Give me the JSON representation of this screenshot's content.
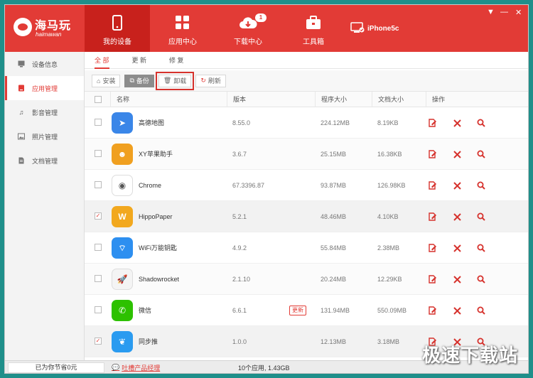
{
  "app": {
    "logo_cn": "海马玩",
    "logo_en": "haimawan"
  },
  "nav": [
    {
      "label": "我的设备",
      "icon": "phone-icon"
    },
    {
      "label": "应用中心",
      "icon": "grid-apps-icon"
    },
    {
      "label": "下载中心",
      "icon": "cloud-download-icon",
      "badge": "1"
    },
    {
      "label": "工具箱",
      "icon": "toolbox-icon"
    }
  ],
  "device": {
    "name": "iPhone5c",
    "icon": "device-connected-icon"
  },
  "window_controls": {
    "menu": "▼",
    "minimize": "—",
    "close": "✕"
  },
  "sidebar": {
    "items": [
      {
        "label": "设备信息",
        "icon": "monitor-icon"
      },
      {
        "label": "应用管理",
        "icon": "app-box-icon",
        "active": true
      },
      {
        "label": "影音管理",
        "icon": "music-note-icon"
      },
      {
        "label": "照片管理",
        "icon": "photo-icon"
      },
      {
        "label": "文档管理",
        "icon": "document-icon"
      }
    ]
  },
  "subtabs": [
    {
      "label": "全 部",
      "active": true
    },
    {
      "label": "更 新"
    },
    {
      "label": "修 复"
    }
  ],
  "toolbar": {
    "install": "安装",
    "backup": "备份",
    "uninstall": "卸载",
    "refresh": "刷新"
  },
  "table": {
    "headers": {
      "name": "名称",
      "version": "版本",
      "app_size": "程序大小",
      "doc_size": "文档大小",
      "actions": "操作"
    },
    "update_label": "更新",
    "rows": [
      {
        "name": "高德地图",
        "version": "8.55.0",
        "app_size": "224.12MB",
        "doc_size": "8.19KB",
        "checked": false,
        "icon": "amap-icon",
        "color": "#3a86e8"
      },
      {
        "name": "XY苹果助手",
        "version": "3.6.7",
        "app_size": "25.15MB",
        "doc_size": "16.38KB",
        "checked": false,
        "icon": "xy-assistant-icon",
        "color": "#f0a020"
      },
      {
        "name": "Chrome",
        "version": "67.3396.87",
        "app_size": "93.87MB",
        "doc_size": "126.98KB",
        "checked": false,
        "icon": "chrome-icon",
        "color": "#ffffff"
      },
      {
        "name": "HippoPaper",
        "version": "5.2.1",
        "app_size": "48.46MB",
        "doc_size": "4.10KB",
        "checked": true,
        "icon": "hippopaper-icon",
        "color": "#f2a81e"
      },
      {
        "name": "WiFi万能钥匙",
        "version": "4.9.2",
        "app_size": "55.84MB",
        "doc_size": "2.38MB",
        "checked": false,
        "icon": "wifi-key-icon",
        "color": "#2d8ff0"
      },
      {
        "name": "Shadowrocket",
        "version": "2.1.10",
        "app_size": "20.24MB",
        "doc_size": "12.29KB",
        "checked": false,
        "icon": "rocket-icon",
        "color": "#f4f4f4"
      },
      {
        "name": "微信",
        "version": "6.6.1",
        "app_size": "131.94MB",
        "doc_size": "550.09MB",
        "checked": false,
        "update": true,
        "icon": "wechat-icon",
        "color": "#2dc100"
      },
      {
        "name": "同步推",
        "version": "1.0.0",
        "app_size": "12.13MB",
        "doc_size": "3.18MB",
        "checked": true,
        "icon": "tongbutui-icon",
        "color": "#2a9bf0"
      }
    ]
  },
  "status": {
    "saved": "已为你节省0元",
    "feedback": "吐槽产品经理",
    "summary": "10个应用, 1.43GB"
  },
  "watermark": "极速下载站",
  "colors": {
    "accent": "#e23b36",
    "accent_dark": "#c8211c"
  }
}
